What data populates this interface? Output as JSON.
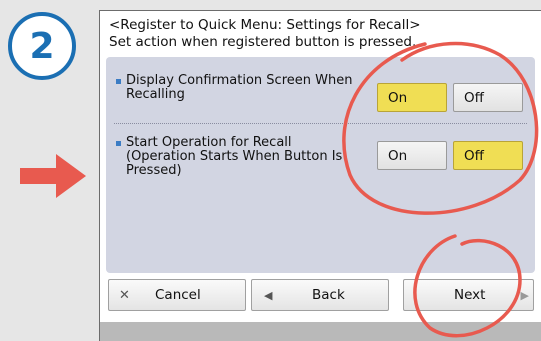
{
  "step": {
    "number": "2",
    "color": "#1b6fb3"
  },
  "arrow": {
    "color": "#e85a4f",
    "icon": "right-arrow-icon"
  },
  "header": {
    "line1": "<Register to Quick Menu: Settings for Recall>",
    "line2": "Set action when registered button is pressed."
  },
  "settings": [
    {
      "label_line1": "Display Confirmation Screen When",
      "label_line2": "Recalling",
      "label_line3": "",
      "on_label": "On",
      "off_label": "Off",
      "selected": "On"
    },
    {
      "label_line1": "Start Operation for Recall",
      "label_line2": "(Operation Starts When Button Is",
      "label_line3": "Pressed)",
      "on_label": "On",
      "off_label": "Off",
      "selected": "Off"
    }
  ],
  "buttons": {
    "cancel": {
      "label": "Cancel",
      "icon": "close-icon"
    },
    "back": {
      "label": "Back",
      "icon": "left-triangle-icon"
    },
    "next": {
      "label": "Next",
      "icon": "right-triangle-icon"
    }
  },
  "colors": {
    "selected": "#f0de54",
    "annotation": "#e85a4f",
    "settings_bg": "#d2d5e2"
  }
}
